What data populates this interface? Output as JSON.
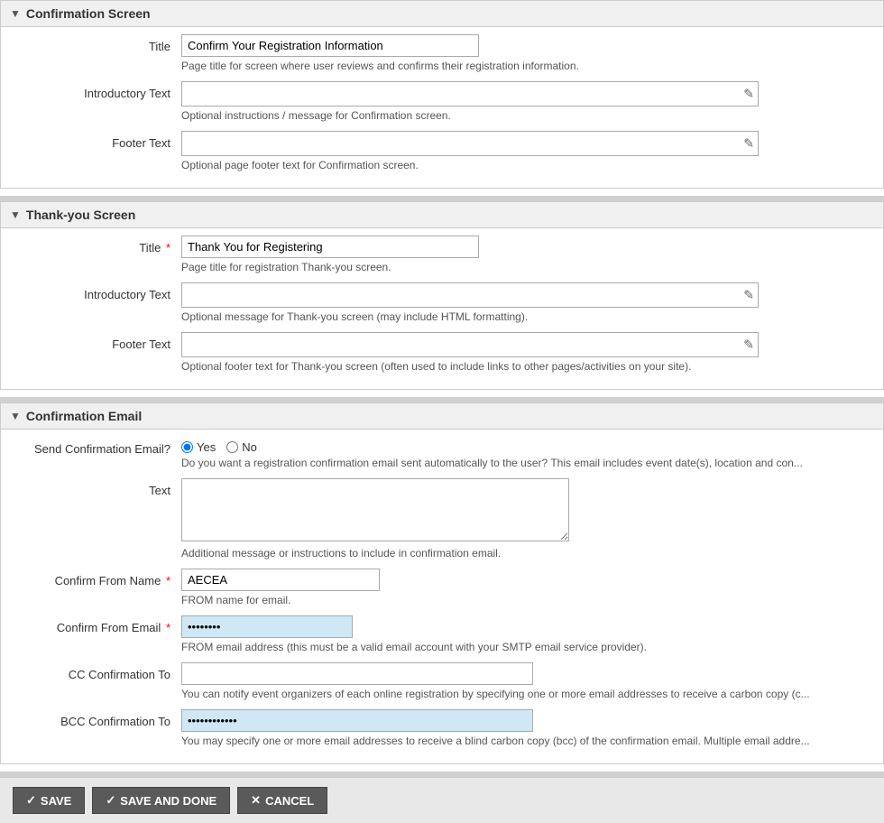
{
  "confirmation_screen": {
    "section_title": "Confirmation Screen",
    "title_field": {
      "label": "Title",
      "value": "Confirm Your Registration Information",
      "hint": "Page title for screen where user reviews and confirms their registration information."
    },
    "introductory_text": {
      "label": "Introductory Text",
      "hint": "Optional instructions / message for Confirmation screen."
    },
    "footer_text": {
      "label": "Footer Text",
      "hint": "Optional page footer text for Confirmation screen."
    }
  },
  "thank_you_screen": {
    "section_title": "Thank-you Screen",
    "title_field": {
      "label": "Title",
      "required": true,
      "value": "Thank You for Registering",
      "hint": "Page title for registration Thank-you screen."
    },
    "introductory_text": {
      "label": "Introductory Text",
      "hint": "Optional message for Thank-you screen (may include HTML formatting)."
    },
    "footer_text": {
      "label": "Footer Text",
      "hint": "Optional footer text for Thank-you screen (often used to include links to other pages/activities on your site)."
    }
  },
  "confirmation_email": {
    "section_title": "Confirmation Email",
    "send_confirmation": {
      "label": "Send Confirmation Email?",
      "options": [
        "Yes",
        "No"
      ],
      "selected": "Yes",
      "hint": "Do you want a registration confirmation email sent automatically to the user? This email includes event date(s), location and con..."
    },
    "text": {
      "label": "Text",
      "hint": "Additional message or instructions to include in confirmation email."
    },
    "confirm_from_name": {
      "label": "Confirm From Name",
      "required": true,
      "value": "AECEA",
      "hint": "FROM name for email."
    },
    "confirm_from_email": {
      "label": "Confirm From Email",
      "required": true,
      "value": "···",
      "hint": "FROM email address (this must be a valid email account with your SMTP email service provider)."
    },
    "cc_confirmation_to": {
      "label": "CC Confirmation To",
      "hint": "You can notify event organizers of each online registration by specifying one or more email addresses to receive a carbon copy (c..."
    },
    "bcc_confirmation_to": {
      "label": "BCC Confirmation To",
      "value": "···",
      "hint": "You may specify one or more email addresses to receive a blind carbon copy (bcc) of the confirmation email. Multiple email addre..."
    }
  },
  "buttons": {
    "save": "SAVE",
    "save_and_done": "SAVE AND DONE",
    "cancel": "CANCEL"
  }
}
